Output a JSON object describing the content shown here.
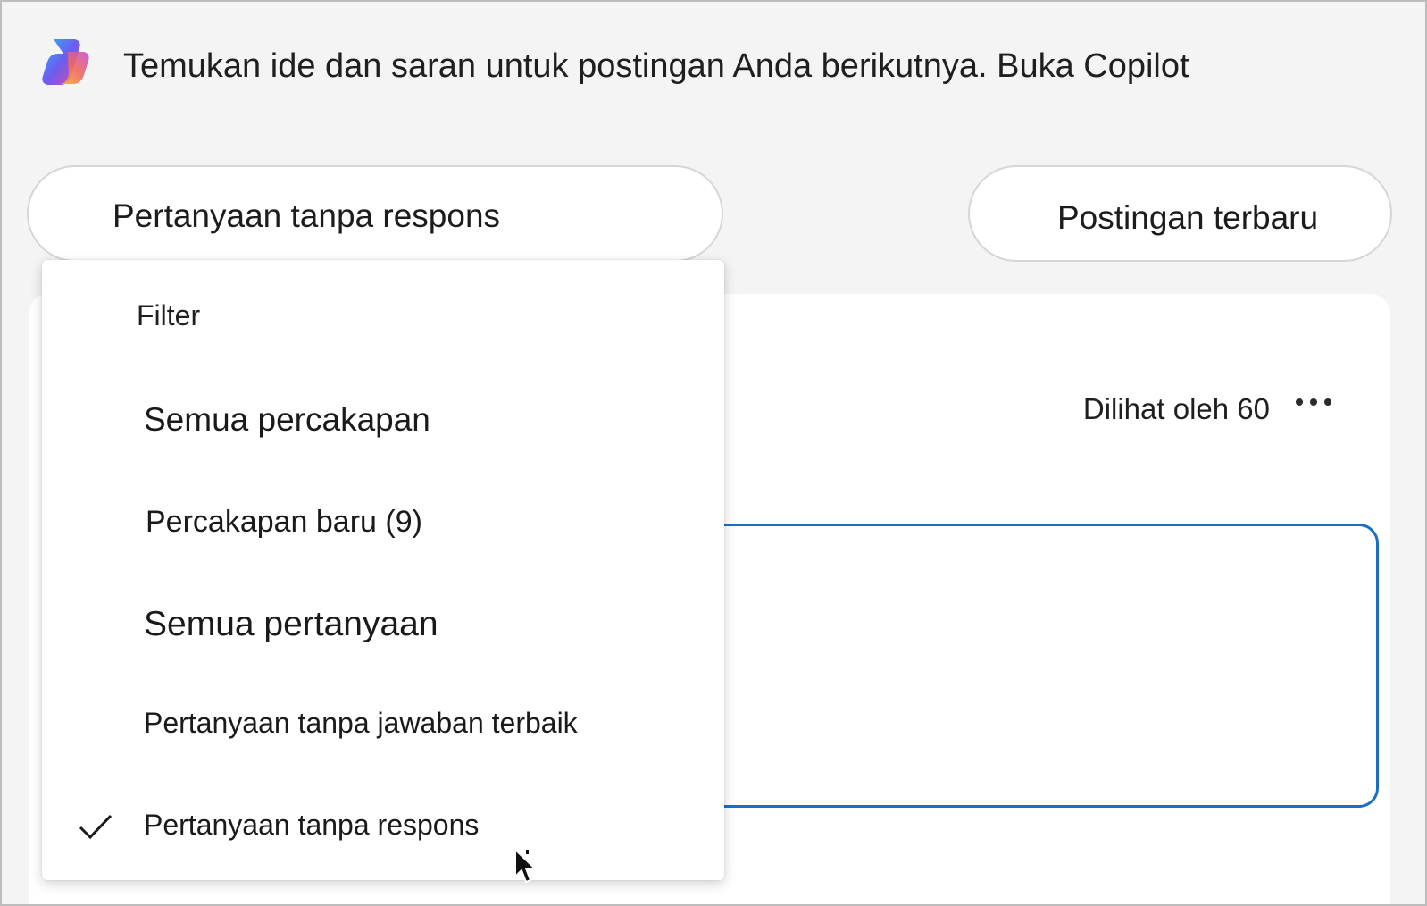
{
  "banner": {
    "text": "Temukan ide dan saran untuk postingan Anda berikutnya. Buka Copilot",
    "icon": "copilot-icon"
  },
  "toolbar": {
    "filter_label": "Pertanyaan tanpa respons",
    "sort_label": "Postingan terbaru"
  },
  "post": {
    "views_label": "Dilihat oleh 60",
    "more_icon": "more-options-icon"
  },
  "filter_menu": {
    "title": "Filter",
    "items": [
      {
        "label": "Semua percakapan",
        "selected": false
      },
      {
        "label": "Percakapan baru (9)",
        "selected": false
      },
      {
        "label": "Semua pertanyaan",
        "selected": false
      },
      {
        "label": "Pertanyaan tanpa jawaban terbaik",
        "selected": false
      },
      {
        "label": "Pertanyaan tanpa respons",
        "selected": true
      }
    ]
  },
  "colors": {
    "accent": "#1a6fc4",
    "background": "#f4f4f4",
    "surface": "#ffffff"
  }
}
